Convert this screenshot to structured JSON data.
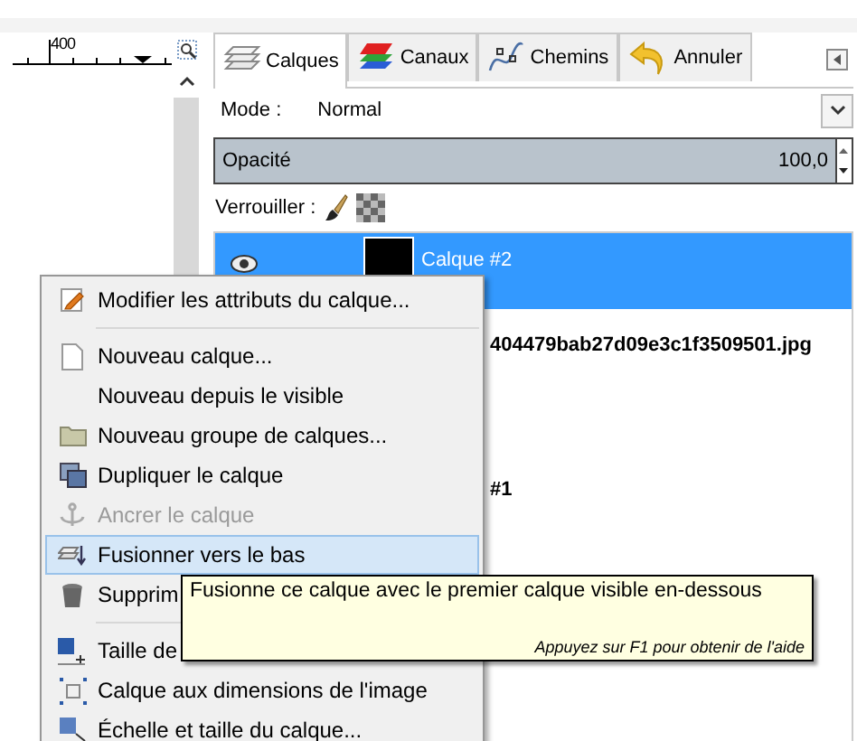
{
  "ruler": {
    "label": "400"
  },
  "tabs": [
    {
      "label": "Calques",
      "selected": true
    },
    {
      "label": "Canaux",
      "selected": false
    },
    {
      "label": "Chemins",
      "selected": false
    },
    {
      "label": "Annuler",
      "selected": false
    }
  ],
  "mode": {
    "label": "Mode :",
    "value": "Normal"
  },
  "opacity": {
    "label": "Opacité",
    "value": "100,0",
    "level": 1
  },
  "lock": {
    "label": "Verrouiller :"
  },
  "layers": [
    {
      "name": "Calque #2",
      "selected": true
    },
    {
      "name": "404479bab27d09e3c1f3509501.jpg",
      "selected": false
    },
    {
      "name": "#1",
      "selected": false
    }
  ],
  "context_menu": {
    "items": [
      {
        "kind": "item",
        "label": "Modifier les attributs du calque...",
        "disabled": false,
        "highlighted": false
      },
      {
        "kind": "separator"
      },
      {
        "kind": "item",
        "label": "Nouveau calque...",
        "disabled": false,
        "highlighted": false
      },
      {
        "kind": "item",
        "label": "Nouveau depuis le visible",
        "disabled": false,
        "highlighted": false
      },
      {
        "kind": "item",
        "label": "Nouveau groupe de calques...",
        "disabled": false,
        "highlighted": false
      },
      {
        "kind": "item",
        "label": "Dupliquer le calque",
        "disabled": false,
        "highlighted": false
      },
      {
        "kind": "item",
        "label": "Ancrer le calque",
        "disabled": true,
        "highlighted": false
      },
      {
        "kind": "item",
        "label": "Fusionner vers le bas",
        "disabled": false,
        "highlighted": true
      },
      {
        "kind": "item",
        "label": "Supprim",
        "disabled": false,
        "highlighted": false
      },
      {
        "kind": "separator"
      },
      {
        "kind": "item",
        "label": "Taille de",
        "disabled": false,
        "highlighted": false
      },
      {
        "kind": "item",
        "label": "Calque aux dimensions de l'image",
        "disabled": false,
        "highlighted": false
      },
      {
        "kind": "item",
        "label": "Échelle et taille du calque...",
        "disabled": false,
        "highlighted": false
      }
    ]
  },
  "tooltip": {
    "text": "Fusionne ce calque avec le premier calque visible en-dessous",
    "hint": "Appuyez sur F1 pour obtenir de l'aide"
  }
}
